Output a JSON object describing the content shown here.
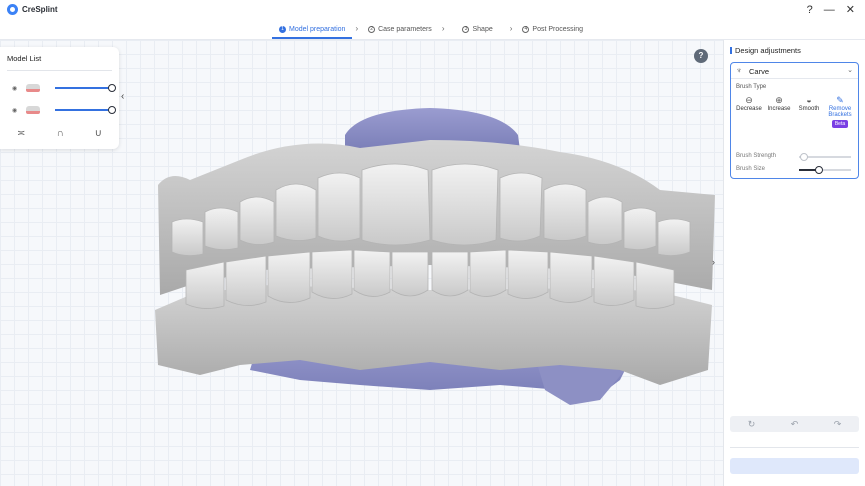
{
  "app": {
    "name": "CreSplint",
    "brand_color": "#3471e0"
  },
  "steps": [
    {
      "num": "1",
      "label": "Model preparation",
      "active": true
    },
    {
      "num": "2",
      "label": "Case parameters",
      "active": false
    },
    {
      "num": "3",
      "label": "Shape",
      "active": false
    },
    {
      "num": "4",
      "label": "Post Processing",
      "active": false
    }
  ],
  "window_controls": {
    "help": "?",
    "minimize": "—",
    "close": "✕"
  },
  "model_list": {
    "title": "Model List",
    "items": [
      {
        "icon": "eye-icon",
        "thumb": "upper-jaw-thumbnail",
        "opacity": 1.0
      },
      {
        "icon": "eye-icon",
        "thumb": "lower-jaw-thumbnail",
        "opacity": 1.0
      }
    ],
    "view_icons": [
      "both-jaws-icon",
      "upper-jaw-icon",
      "lower-jaw-icon"
    ]
  },
  "viewport": {
    "help_glyph": "?"
  },
  "design_panel": {
    "title": "Design adjustments",
    "tool": {
      "label": "Carve"
    },
    "brush_type_label": "Brush Type",
    "brushes": [
      {
        "label": "Decrease",
        "icon": "decrease-brush-icon",
        "active": false
      },
      {
        "label": "Increase",
        "icon": "increase-brush-icon",
        "active": false
      },
      {
        "label": "Smooth",
        "icon": "smooth-brush-icon",
        "active": false
      },
      {
        "label": "Remove Brackets",
        "icon": "remove-brackets-icon",
        "active": true,
        "badge": "Beta"
      }
    ],
    "params": [
      {
        "label": "Brush Strength",
        "value": 0.1,
        "enabled": false
      },
      {
        "label": "Brush Size",
        "value": 0.4,
        "enabled": true
      }
    ],
    "tools": [
      "reset-icon",
      "undo-icon",
      "redo-icon"
    ]
  }
}
